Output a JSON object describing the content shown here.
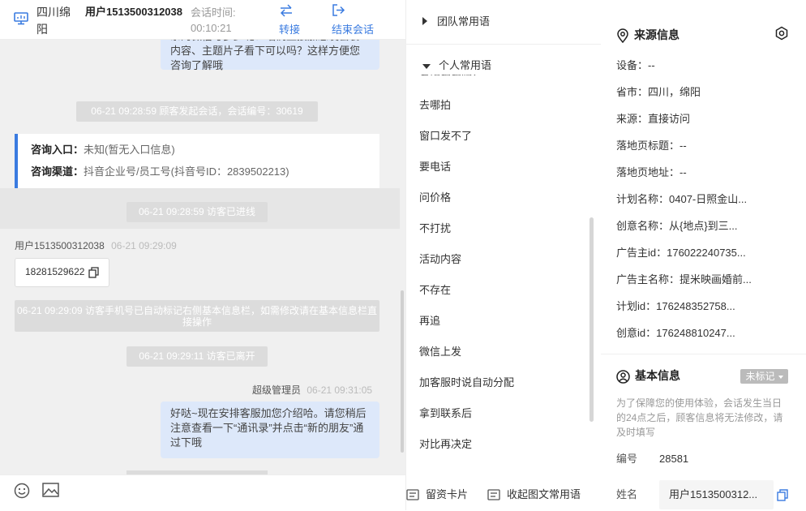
{
  "header": {
    "location": "四川绵阳",
    "user": "用户1513500312038",
    "session_time_label": "会话时间:",
    "session_time": "00:10:21",
    "transfer_label": "转接",
    "end_label": "结束会话"
  },
  "chat": {
    "partial_bubble": "亲的微信号多少呢？咱们直接加您发套餐内容、主题片子看下可以吗？这样方便您咨询了解哦",
    "sys_session_start": "06-21 09:28:59 顾客发起会话，会话编号：30619",
    "consult_entry_label": "咨询入口：",
    "consult_entry_value": "未知(暂无入口信息)",
    "consult_channel_label": "咨询渠道：",
    "consult_channel_value": "抖音企业号/员工号(抖音号ID：2839502213)",
    "sys_enter": "06-21 09:28:59 访客已进线",
    "visitor_name": "用户1513500312038",
    "visitor_time": "06-21 09:29:09",
    "visitor_message": "18281529622",
    "sys_autotag": "06-21 09:29:09 访客手机号已自动标记右侧基本信息栏，如需修改请在基本信息栏直接操作",
    "sys_leave": "06-21 09:29:11 访客已离开",
    "agent_name": "超级管理员",
    "agent_time": "06-21 09:31:05",
    "agent_message": "好哒~现在安排客服加您介绍哈。请您稍后注意查看一下“通讯录”并点击“新的朋友”通过下哦"
  },
  "inputbar": {
    "emoji_icon": "smile-icon",
    "image_icon": "image-icon",
    "card_label": "留资卡片",
    "collapse_label": "收起图文常用语"
  },
  "phrases": {
    "team_label": "团队常用语",
    "personal_label": "个人常用语",
    "cut_item": "考虑拍拍吗？",
    "items": [
      "去哪拍",
      "窗口发不了",
      "要电话",
      "问价格",
      "不打扰",
      "活动内容",
      "不存在",
      "再追",
      "微信上发",
      "加客服时说自动分配",
      "拿到联系后",
      "对比再决定"
    ]
  },
  "info": {
    "source_title": "来源信息",
    "source_rows": [
      "设备：--",
      "省市：四川，绵阳",
      "来源：直接访问",
      "落地页标题：--",
      "落地页地址：--",
      "计划名称：0407-日照金山...",
      "创意名称：从{地点}到三...",
      "广告主id：176022240735...",
      "广告主名称：提米映画婚前...",
      "计划id：176248352758...",
      "创意id：176248810247..."
    ],
    "basic_title": "基本信息",
    "tag_label": "未标记",
    "notice": "为了保障您的使用体验，会话发生当日的24点之后，顾客信息将无法修改，请及时填写",
    "id_label": "编号",
    "id_value": "28581",
    "name_label": "姓名",
    "name_value": "用户1513500312..."
  },
  "colors": {
    "accent": "#3a7be0",
    "bubble_blue": "#dde8fa",
    "system_gray": "#dcdcdc",
    "chat_bg": "#f0f0f0"
  }
}
